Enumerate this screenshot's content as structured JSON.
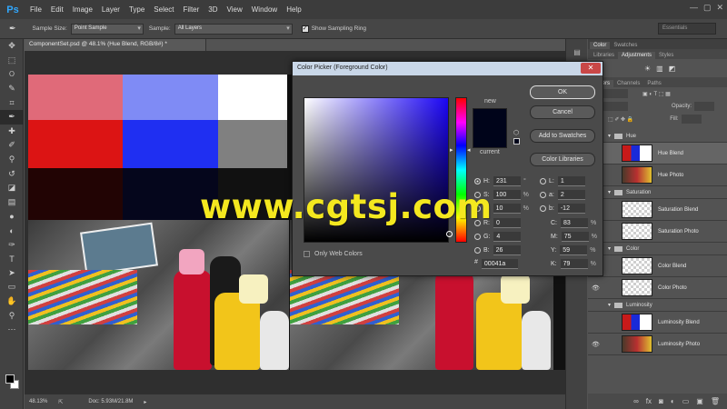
{
  "app": {
    "logo": "Ps",
    "menu": [
      "File",
      "Edit",
      "Image",
      "Layer",
      "Type",
      "Select",
      "Filter",
      "3D",
      "View",
      "Window",
      "Help"
    ],
    "window_controls": [
      "—",
      "▢",
      "✕"
    ]
  },
  "options": {
    "sample_size_label": "Sample Size:",
    "sample_size_value": "Point Sample",
    "sample_label": "Sample:",
    "sample_value": "All Layers",
    "show_ring_label": "Show Sampling Ring",
    "workspace": "Essentials"
  },
  "document": {
    "tab_title": "ComponentSet.psd @ 48.1% (Hue Blend, RGB/8#) *",
    "zoom": "48.13%",
    "doc_size": "Doc: 5.93M/21.8M",
    "swatches": [
      "#e06a79",
      "#7f8bf5",
      "#ffffff",
      "#dc1414",
      "#1f2ff2",
      "#808080",
      "#220404",
      "#05061c",
      "#111111"
    ]
  },
  "watermark": "www.cgtsj.com",
  "dialog": {
    "title": "Color Picker (Foreground Color)",
    "new_label": "new",
    "current_label": "current",
    "new_color": "#00041a",
    "buttons": {
      "ok": "OK",
      "cancel": "Cancel",
      "add_swatches": "Add to Swatches",
      "libraries": "Color Libraries"
    },
    "only_web": "Only Web Colors",
    "fields": {
      "H": {
        "label": "H:",
        "value": "231",
        "unit": "°"
      },
      "S": {
        "label": "S:",
        "value": "100",
        "unit": "%"
      },
      "Bv": {
        "label": "B:",
        "value": "10",
        "unit": "%"
      },
      "R": {
        "label": "R:",
        "value": "0"
      },
      "G": {
        "label": "G:",
        "value": "4"
      },
      "B": {
        "label": "B:",
        "value": "26"
      },
      "L": {
        "label": "L:",
        "value": "1"
      },
      "a": {
        "label": "a:",
        "value": "2"
      },
      "b": {
        "label": "b:",
        "value": "-12"
      },
      "C": {
        "label": "C:",
        "value": "83",
        "unit": "%"
      },
      "M": {
        "label": "M:",
        "value": "75",
        "unit": "%"
      },
      "Y": {
        "label": "Y:",
        "value": "59",
        "unit": "%"
      },
      "K": {
        "label": "K:",
        "value": "79",
        "unit": "%"
      }
    },
    "hex_label": "#",
    "hex": "00041a"
  },
  "panels": {
    "top_tabs": [
      "Color",
      "Swatches"
    ],
    "mid_tabs": [
      "Libraries",
      "Adjustments",
      "Styles"
    ],
    "layer_tabs": [
      "Layers",
      "Channels",
      "Paths"
    ],
    "opacity_label": "Opacity:",
    "fill_label": "Fill:",
    "layers": [
      {
        "type": "group",
        "name": "Hue"
      },
      {
        "type": "layer",
        "name": "Hue Blend",
        "selected": true
      },
      {
        "type": "layer",
        "name": "Hue Photo"
      },
      {
        "type": "group",
        "name": "Saturation"
      },
      {
        "type": "layer",
        "name": "Saturation Blend"
      },
      {
        "type": "layer",
        "name": "Saturation Photo"
      },
      {
        "type": "group",
        "name": "Color"
      },
      {
        "type": "layer",
        "name": "Color Blend"
      },
      {
        "type": "layer",
        "name": "Color Photo"
      },
      {
        "type": "group",
        "name": "Luminosity"
      },
      {
        "type": "layer",
        "name": "Luminosity Blend"
      },
      {
        "type": "layer",
        "name": "Luminosity Photo"
      }
    ]
  }
}
